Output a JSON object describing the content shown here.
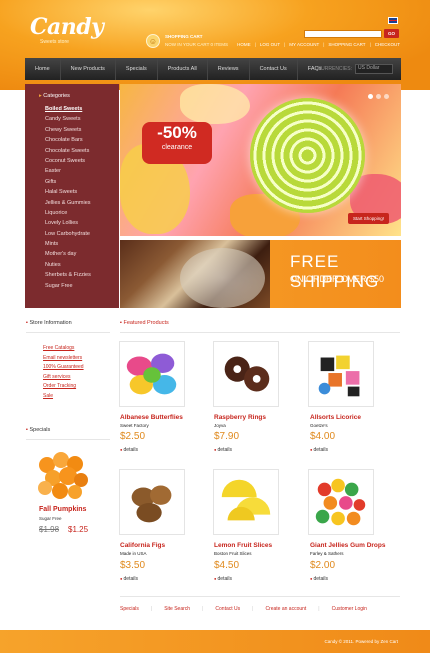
{
  "header": {
    "logo": "Candy",
    "tagline": "Sweets store",
    "cart_title": "SHOPPING CART",
    "cart_status": "NOW IN YOUR CART 0 ITEMS",
    "search_button": "GO",
    "top_links": [
      "HOME",
      "LOG OUT",
      "MY ACCOUNT",
      "SHOPPING CART",
      "CHECKOUT"
    ]
  },
  "nav": {
    "items": [
      "Home",
      "New Products",
      "Specials",
      "Products All",
      "Reviews",
      "Contact Us",
      "FAQs"
    ],
    "currency_label": "CURRENCIES:",
    "currency_value": "US Dollar"
  },
  "categories": {
    "title": "Categories",
    "items": [
      "Boiled Sweets",
      "Candy Sweets",
      "Chewy Sweets",
      "Chocolate Bars",
      "Chocolate Sweets",
      "Coconut Sweets",
      "Easter",
      "Gifts",
      "Halal Sweets",
      "Jellies & Gummies",
      "Liquorice",
      "Lovely Lollies",
      "Low Carbohydrate",
      "Mints",
      "Mother's day",
      "Nuties",
      "Sherbets & Fizzies",
      "Sugar Free"
    ]
  },
  "banner1": {
    "discount": "-50%",
    "label": "clearance",
    "button": "Start Shopping!"
  },
  "banner2": {
    "line1": "FREE SHIPPING",
    "line2": "ON ORDER OVER $50"
  },
  "info": {
    "title": "Store Information",
    "links": [
      "Free Catalogs",
      "Email newsletters",
      "100% Guaranteed",
      "Gift services",
      "Order Tracking",
      "Sale"
    ]
  },
  "specials": {
    "title": "Specials",
    "name": "Fall Pumpkins",
    "sub": "Sugar Free",
    "old_price": "$1.98",
    "new_price": "$1.25"
  },
  "featured": {
    "title": "Featured Products",
    "products": [
      {
        "name": "Albanese Butterflies",
        "sub": "Sweet Factory",
        "price": "$2.50",
        "details": "details"
      },
      {
        "name": "Raspberry Rings",
        "sub": "Joyva",
        "price": "$7.90",
        "details": "details"
      },
      {
        "name": "Allsorts Licorice",
        "sub": "Goetze's",
        "price": "$4.00",
        "details": "details"
      },
      {
        "name": "California Figs",
        "sub": "Made in USA",
        "price": "$3.50",
        "details": "details"
      },
      {
        "name": "Lemon Fruit Slices",
        "sub": "Boston Fruit Slices",
        "price": "$4.50",
        "details": "details"
      },
      {
        "name": "Giant Jellies Gum Drops",
        "sub": "Farley & Sathers",
        "price": "$2.00",
        "details": "details"
      }
    ]
  },
  "footer": {
    "links": [
      "Specials",
      "Site Search",
      "Contact Us",
      "Create an account",
      "Customer Login"
    ],
    "copyright": "Candy © 2011. Powered by Zen Cart"
  },
  "colors": {
    "accent": "#c7251d",
    "orange": "#f39a22",
    "nav": "#2e2e2e",
    "sidebar": "#7c2b2e"
  }
}
